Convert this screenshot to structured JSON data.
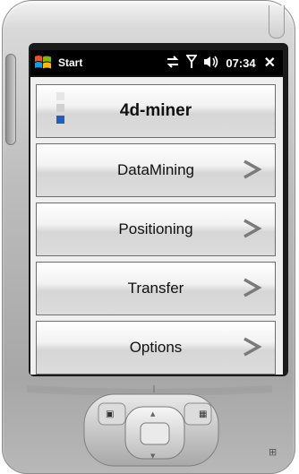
{
  "statusbar": {
    "start_label": "Start",
    "time": "07:34",
    "close_glyph": "✕",
    "icons": [
      "windows-flag-icon",
      "connectivity-icon",
      "signal-icon",
      "speaker-icon"
    ]
  },
  "menu": {
    "header": "4d-miner",
    "items": [
      {
        "label": "DataMining"
      },
      {
        "label": "Positioning"
      },
      {
        "label": "Transfer"
      },
      {
        "label": "Options"
      }
    ]
  },
  "colors": {
    "accent_blue": "#1f5fbf",
    "statusbar_bg": "#000000"
  }
}
